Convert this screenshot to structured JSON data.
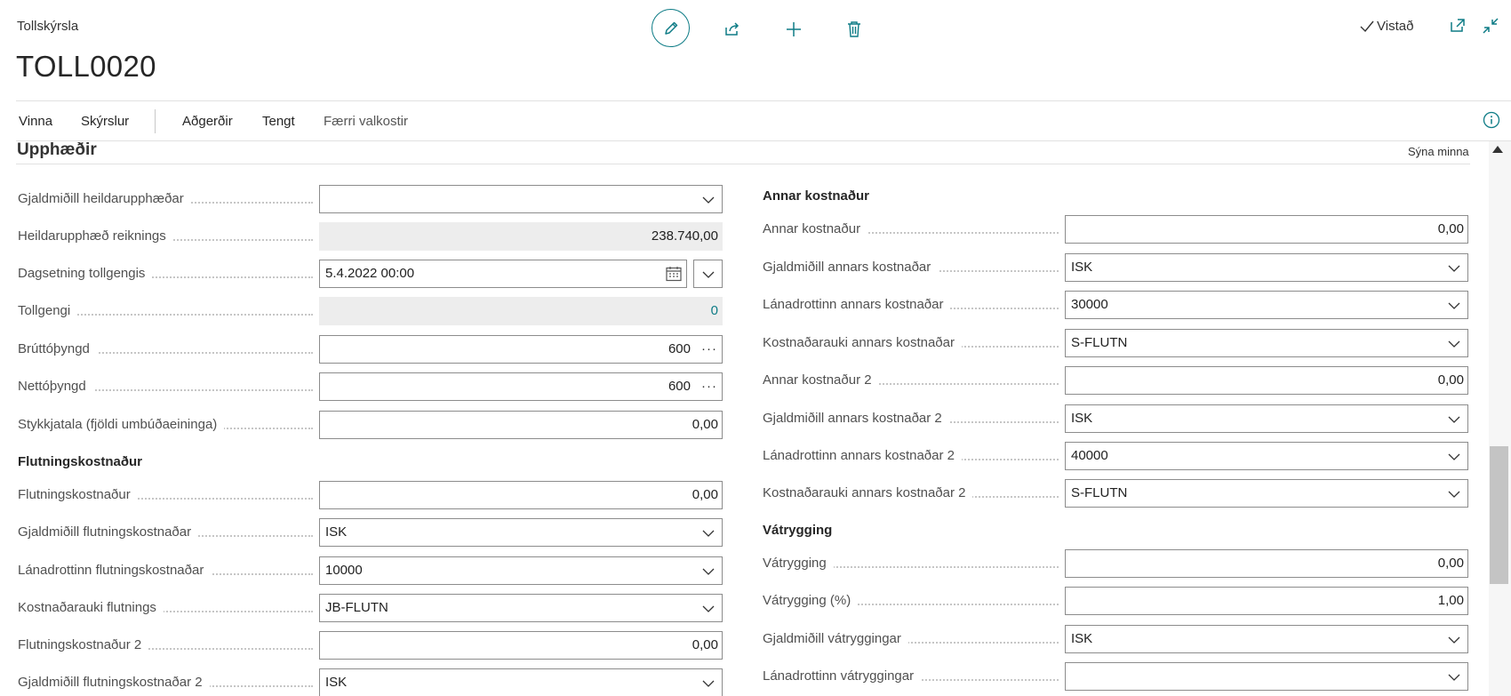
{
  "header": {
    "caption": "Tollskýrsla",
    "title": "TOLL0020",
    "status": "Vistað"
  },
  "actionbar": {
    "items": [
      "Vinna",
      "Skýrslur",
      "Aðgerðir",
      "Tengt",
      "Færri valkostir"
    ]
  },
  "section": {
    "title": "Upphæðir",
    "toggle": "Sýna minna"
  },
  "left": {
    "f1": {
      "label": "Gjaldmiðill heildarupphæðar",
      "value": ""
    },
    "f2": {
      "label": "Heildarupphæð reiknings",
      "value": "238.740,00"
    },
    "f3": {
      "label": "Dagsetning tollgengis",
      "value": "5.4.2022 00:00"
    },
    "f4": {
      "label": "Tollgengi",
      "value": "0"
    },
    "f5": {
      "label": "Brúttóþyngd",
      "value": "600"
    },
    "f6": {
      "label": "Nettóþyngd",
      "value": "600"
    },
    "f7": {
      "label": "Stykkjatala (fjöldi umbúðaeininga)",
      "value": "0,00"
    },
    "group": "Flutningskostnaður",
    "f8": {
      "label": "Flutningskostnaður",
      "value": "0,00"
    },
    "f9": {
      "label": "Gjaldmiðill flutningskostnaðar",
      "value": "ISK"
    },
    "f10": {
      "label": "Lánadrottinn flutningskostnaðar",
      "value": "10000"
    },
    "f11": {
      "label": "Kostnaðarauki flutnings",
      "value": "JB-FLUTN"
    },
    "f12": {
      "label": "Flutningskostnaður 2",
      "value": "0,00"
    },
    "f13": {
      "label": "Gjaldmiðill flutningskostnaðar 2",
      "value": "ISK"
    }
  },
  "right": {
    "group1": "Annar kostnaður",
    "f1": {
      "label": "Annar kostnaður",
      "value": "0,00"
    },
    "f2": {
      "label": "Gjaldmiðill annars kostnaðar",
      "value": "ISK"
    },
    "f3": {
      "label": "Lánadrottinn annars kostnaðar",
      "value": "30000"
    },
    "f4": {
      "label": "Kostnaðarauki annars kostnaðar",
      "value": "S-FLUTN"
    },
    "f5": {
      "label": "Annar kostnaður 2",
      "value": "0,00"
    },
    "f6": {
      "label": "Gjaldmiðill annars kostnaðar 2",
      "value": "ISK"
    },
    "f7": {
      "label": "Lánadrottinn annars kostnaðar 2",
      "value": "40000"
    },
    "f8": {
      "label": "Kostnaðarauki annars kostnaðar 2",
      "value": "S-FLUTN"
    },
    "group2": "Vátrygging",
    "f9": {
      "label": "Vátrygging",
      "value": "0,00"
    },
    "f10": {
      "label": "Vátrygging (%)",
      "value": "1,00"
    },
    "f11": {
      "label": "Gjaldmiðill vátryggingar",
      "value": "ISK"
    },
    "f12": {
      "label": "Lánadrottinn vátryggingar",
      "value": ""
    }
  },
  "colors": {
    "accent": "#0e7c86",
    "readonly_bg": "#ededed"
  },
  "icons": [
    "edit-icon",
    "share-icon",
    "add-icon",
    "delete-icon",
    "checkmark-icon",
    "popout-icon",
    "collapse-icon",
    "info-icon",
    "chevron-down-icon",
    "calendar-icon",
    "more-icon"
  ]
}
